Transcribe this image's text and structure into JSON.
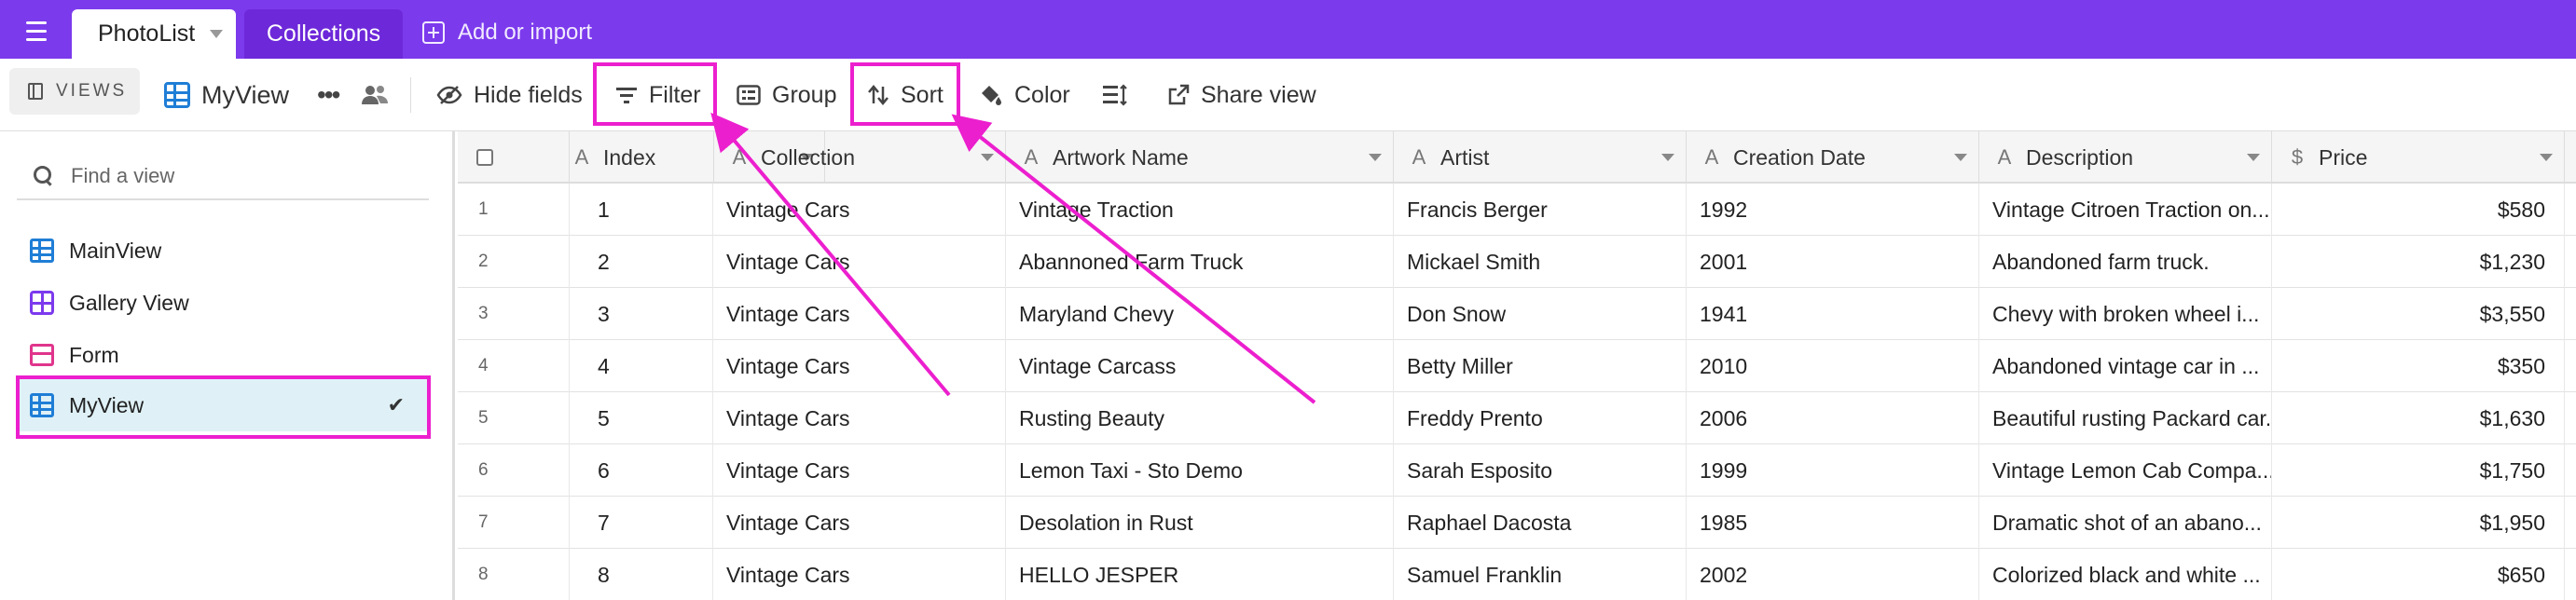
{
  "tabs": [
    {
      "label": "PhotoList",
      "active": true
    },
    {
      "label": "Collections",
      "active": false
    }
  ],
  "add_import_label": "Add or import",
  "toolbar": {
    "views_label": "VIEWS",
    "current_view": "MyView",
    "hide_fields": "Hide fields",
    "filter": "Filter",
    "group": "Group",
    "sort": "Sort",
    "color": "Color",
    "share_view": "Share view"
  },
  "sidebar": {
    "search_placeholder": "Find a view",
    "views": [
      {
        "label": "MainView",
        "icon": "grid-view-icon"
      },
      {
        "label": "Gallery View",
        "icon": "gallery-view-icon"
      },
      {
        "label": "Form",
        "icon": "form-view-icon"
      },
      {
        "label": "MyView",
        "icon": "grid-view-icon",
        "selected": true
      }
    ],
    "selected_check": "✔"
  },
  "table": {
    "columns": [
      "Index",
      "Collection",
      "Artwork Name",
      "Artist",
      "Creation Date",
      "Description",
      "Price"
    ],
    "rows": [
      {
        "n": "1",
        "index": "1",
        "collection": "Vintage Cars",
        "artwork": "Vintage Traction",
        "artist": "Francis Berger",
        "date": "1992",
        "description": "Vintage Citroen Traction on...",
        "price": "$580"
      },
      {
        "n": "2",
        "index": "2",
        "collection": "Vintage Cars",
        "artwork": "Abannoned Farm Truck",
        "artist": "Mickael Smith",
        "date": "2001",
        "description": "Abandoned farm truck.",
        "price": "$1,230"
      },
      {
        "n": "3",
        "index": "3",
        "collection": "Vintage Cars",
        "artwork": "Maryland Chevy",
        "artist": "Don Snow",
        "date": "1941",
        "description": "Chevy with broken wheel i...",
        "price": "$3,550"
      },
      {
        "n": "4",
        "index": "4",
        "collection": "Vintage Cars",
        "artwork": "Vintage Carcass",
        "artist": "Betty Miller",
        "date": "2010",
        "description": "Abandoned vintage car in ...",
        "price": "$350"
      },
      {
        "n": "5",
        "index": "5",
        "collection": "Vintage Cars",
        "artwork": "Rusting Beauty",
        "artist": "Freddy Prento",
        "date": "2006",
        "description": "Beautiful rusting Packard car.",
        "price": "$1,630"
      },
      {
        "n": "6",
        "index": "6",
        "collection": "Vintage Cars",
        "artwork": "Lemon Taxi - Sto Demo",
        "artist": "Sarah Esposito",
        "date": "1999",
        "description": "Vintage Lemon Cab Compa...",
        "price": "$1,750"
      },
      {
        "n": "7",
        "index": "7",
        "collection": "Vintage Cars",
        "artwork": "Desolation in Rust",
        "artist": "Raphael Dacosta",
        "date": "1985",
        "description": "Dramatic shot of an abano...",
        "price": "$1,950"
      },
      {
        "n": "8",
        "index": "8",
        "collection": "Vintage Cars",
        "artwork": "HELLO JESPER",
        "artist": "Samuel Franklin",
        "date": "2002",
        "description": "Colorized black and white ...",
        "price": "$650"
      }
    ]
  },
  "colors": {
    "topbar": "#7c3aed",
    "highlight": "#ec1fce",
    "selected_row": "#dff1f7"
  }
}
